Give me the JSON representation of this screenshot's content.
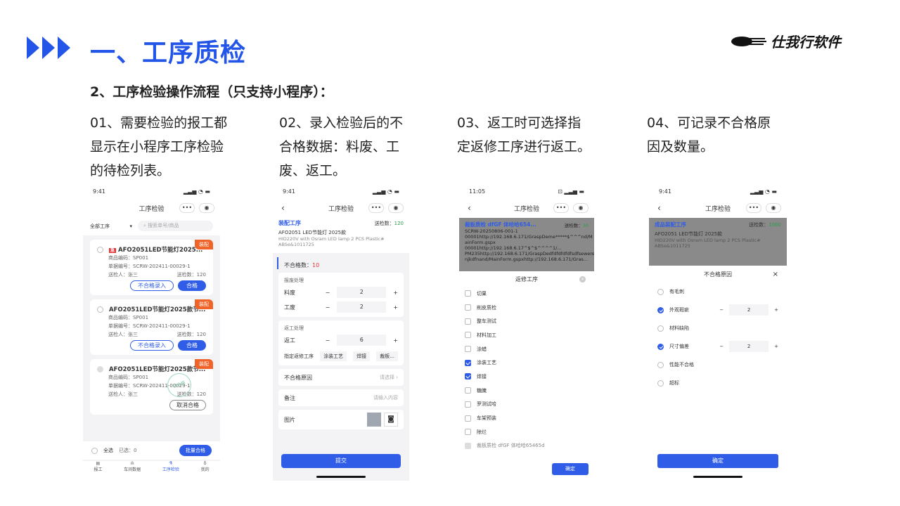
{
  "header": {
    "title": "一、工序质检",
    "logo": "仕我行软件",
    "subtitle": "2、工序检验操作流程（只支持小程序）："
  },
  "steps": [
    {
      "l1": "01、需要检验的报工都",
      "l2": "显示在小程序工序检验",
      "l3": "的待检列表。"
    },
    {
      "l1": "02、录入检验后的不",
      "l2": "合格数据：料废、工",
      "l3": "废、返工。"
    },
    {
      "l1": "03、返工时可选择指",
      "l2": "定返修工序进行返工。",
      "l3": ""
    },
    {
      "l1": "04、可记录不合格原",
      "l2": "因及数量。",
      "l3": ""
    }
  ],
  "p1": {
    "time": "9:41",
    "title": "工序检验",
    "filter": "全部工序",
    "search_ph": "搜索单号/商品",
    "cards": [
      {
        "title": "AFO2051LED节能灯2025...",
        "badge": "装配",
        "flag": "急",
        "code": "商品编码：SP001",
        "doc": "单据编号：SCRW-202411-00029-1",
        "inspector": "送检人：张三",
        "qty": "送检数：120",
        "b1": "不合格录入",
        "b2": "合格"
      },
      {
        "title": "AFO2051LED节能灯2025款节...",
        "badge": "装配",
        "code": "商品编码：SP001",
        "doc": "单据编号：SCRW-202411-00029-1",
        "inspector": "送检人：张三",
        "qty": "送检数：120",
        "b1": "不合格录入",
        "b2": "合格"
      },
      {
        "title": "AFO2051LED节能灯2025款节...",
        "badge": "装配",
        "code": "商品编码：SP001",
        "doc": "单据编号：SCRW-202411-00029-1",
        "inspector": "送检人：张三",
        "qty": "送检数：120",
        "b1": "取消合格",
        "stamp": "已合格"
      }
    ],
    "select_all": "全选",
    "selected": "已选：0",
    "batch": "批量合格",
    "tabs": [
      "报工",
      "车间数据",
      "工序检验",
      "我的"
    ]
  },
  "p2": {
    "time": "9:41",
    "title": "工序检验",
    "proc": "装配工序",
    "qty_label": "送检数：",
    "qty": "120",
    "prod": "AFO2051  LED节能灯  2025款",
    "desc1": "HID220V with Osram  LED  lamp  2 PCS  Plastic#",
    "desc2": "ABSe&1011725",
    "ng_label": "不合格数：",
    "ng": "10",
    "scrap_title": "报废处理",
    "mat": "料废",
    "mat_v": "2",
    "work": "工废",
    "work_v": "2",
    "rework_title": "返工处理",
    "rework": "返工",
    "rework_v": "6",
    "assign": "指定返修工序",
    "ops": [
      "涂装工艺",
      "焊接",
      "裁板..."
    ],
    "reason": "不合格原因",
    "reason_ph": "请选择",
    "remark": "备注",
    "remark_ph": "请输入内容",
    "image": "图片",
    "submit": "提交"
  },
  "p3": {
    "time": "11:05",
    "head": "裁板质检 dfGF 体哈哈654...",
    "qty_label": "送检数：",
    "qty": "30",
    "doc": "SCRW-20250806-001-1",
    "url1": "00001http://192.168.6.171/GraspDeme*****$^^^nd/M",
    "url2": "ainForm.gspx 00001http://192.168.6.17^$^$^^^^1/...",
    "url3": "PM235http://192.168.6.171/GraspDedfdfdfdfdfsdfsewere",
    "url4": "njkdfnand/MainForm.gspxhttp://192.168.6.171/Gras...",
    "modal": "返修工序",
    "items": [
      {
        "t": "切果",
        "on": false
      },
      {
        "t": "削皮质检",
        "on": false
      },
      {
        "t": "整车测试",
        "on": false
      },
      {
        "t": "材料加工",
        "on": false
      },
      {
        "t": "涂蜡",
        "on": false
      },
      {
        "t": "涂装工艺",
        "on": true
      },
      {
        "t": "焊接",
        "on": true
      },
      {
        "t": "糖腌",
        "on": false
      },
      {
        "t": "罗测试哈",
        "on": false
      },
      {
        "t": "车架预装",
        "on": false
      },
      {
        "t": "除烂",
        "on": false
      },
      {
        "t": "裁板质检 dfGF 体哈哈65465d",
        "on": false
      }
    ],
    "confirm": "确定"
  },
  "p4": {
    "time": "9:41",
    "title": "工序检验",
    "proc": "成品装配工序",
    "qty_label": "送检数：",
    "qty": "1000",
    "prod": "AFO2051  LED节能灯  2025款",
    "desc1": "HID220V with Osram  LED  lamp  2 PCS  Plastic#",
    "desc2": "ABSe&1011725",
    "modal": "不合格原因",
    "reasons": [
      {
        "t": "有毛刺",
        "on": false
      },
      {
        "t": "外观瑕疵",
        "on": true,
        "v": "2"
      },
      {
        "t": "材料缺陷",
        "on": false
      },
      {
        "t": "尺寸偏差",
        "on": true,
        "v": "2"
      },
      {
        "t": "性能不合格",
        "on": false
      },
      {
        "t": "超标",
        "on": false
      }
    ],
    "confirm": "确定"
  }
}
